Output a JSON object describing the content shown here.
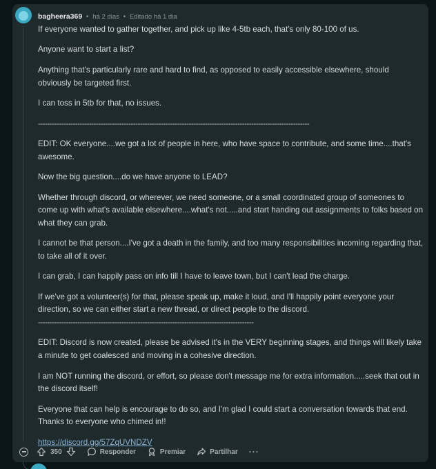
{
  "comment": {
    "username": "bagheera369",
    "posted": "há 2 dias",
    "edited": "Editado há 1 dia",
    "paragraphs": [
      "If everyone wanted to gather together, and pick up like 4-5tb each, that's only 80-100 of us.",
      "Anyone want to start a list?",
      "Anything that's particularly rare and hard to find, as opposed to easily accessible elsewhere, should obviously be targeted first.",
      "I can toss in 5tb for that, no issues.",
      "---------------------------------------------------------------------------------------------------------------------",
      "EDIT: OK everyone....we got a lot of people in here, who have space to contribute, and some time....that's awesome.",
      "Now the big question....do we have anyone to LEAD?",
      "Whether through discord, or wherever, we need someone, or a small coordinated group of someones to come up with what's available elsewhere....what's not.....and start handing out assignments to folks based on what they can grab.",
      "I cannot be that person....I've got a death in the family, and too many responsibilities incoming regarding that, to take all of it over.",
      "I can grab, I can happily pass on info till I have to leave town, but I can't lead the charge.",
      "If we've got a volunteer(s) for that, please speak up, make it loud, and I'll happily point everyone your direction, so we can either start a new thread, or direct people to the discord.",
      "---------------------------------------------------------------------------------------------",
      "EDIT: Discord is now created, please be advised it's in the VERY beginning stages, and things will likely take a minute to get coalesced and moving in a cohesive direction.",
      "I am NOT running the discord, or effort, so please don't message me for extra information.....seek that out in the discord itself!",
      "Everyone that can help is encourage to do so, and I'm glad I could start a conversation towards that end. Thanks to everyone who chimed in!!"
    ],
    "link": "https://discord.gg/57ZqUVNDZV"
  },
  "actions": {
    "vote_count": "350",
    "reply_label": "Responder",
    "award_label": "Premiar",
    "share_label": "Partilhar",
    "more_label": "···"
  },
  "colors": {
    "background": "#0b1416",
    "card": "#1f2a2c",
    "text": "#d7dadc",
    "muted": "#8b9598",
    "link": "#8ab4d6",
    "avatar": "#3aa8c1"
  }
}
